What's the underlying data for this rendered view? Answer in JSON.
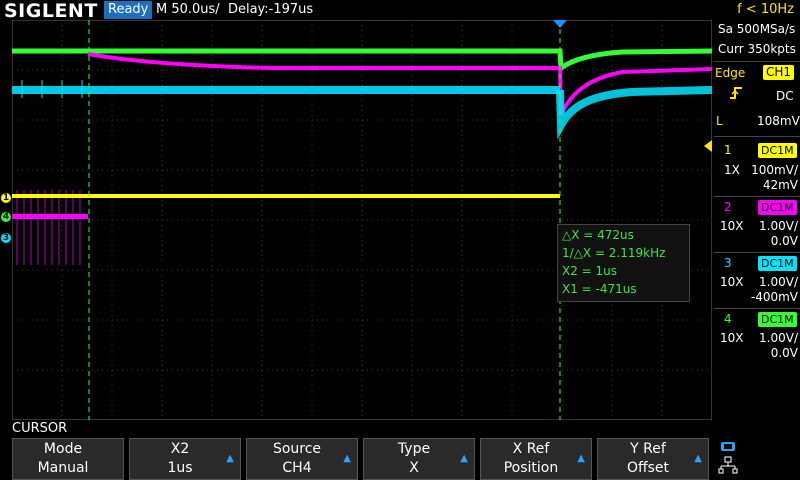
{
  "header": {
    "logo": "SIGLENT",
    "status": "Ready",
    "timebase": "M 50.0us/",
    "delay": "Delay:-197us",
    "trigger_freq": "f < 10Hz"
  },
  "acquisition": {
    "sample_rate": "Sa 500MSa/s",
    "memory": "Curr 350kpts"
  },
  "trigger": {
    "type": "Edge",
    "source": "CH1",
    "coupling": "DC",
    "level_label": "L",
    "level": "108mV"
  },
  "channels": [
    {
      "num": "1",
      "coupling": "DC1M",
      "probe": "1X",
      "scale": "100mV/",
      "offset": "42mV",
      "color": "#ffff00"
    },
    {
      "num": "2",
      "coupling": "DC1M",
      "probe": "10X",
      "scale": "1.00V/",
      "offset": "0.0V",
      "color": "#ff00ff"
    },
    {
      "num": "3",
      "coupling": "DC1M",
      "probe": "10X",
      "scale": "1.00V/",
      "offset": "-400mV",
      "color": "#00e5ff"
    },
    {
      "num": "4",
      "coupling": "DC1M",
      "probe": "10X",
      "scale": "1.00V/",
      "offset": "0.0V",
      "color": "#33ff33"
    }
  ],
  "cursor_readout": {
    "dx": "△X = 472us",
    "inv_dx": "1/△X = 2.119kHz",
    "x2": "X2 = 1us",
    "x1": "X1 = -471us"
  },
  "menu": {
    "title": "CURSOR",
    "softkeys": [
      {
        "title": "Mode",
        "value": "Manual",
        "arrow": false
      },
      {
        "title": "X2",
        "value": "1us",
        "arrow": true
      },
      {
        "title": "Source",
        "value": "CH4",
        "arrow": true
      },
      {
        "title": "Type",
        "value": "X",
        "arrow": true
      },
      {
        "title": "X Ref",
        "value": "Position",
        "arrow": true
      },
      {
        "title": "Y Ref",
        "value": "Offset",
        "arrow": true
      }
    ]
  },
  "colors": {
    "ch1": "#ffff00",
    "ch2": "#ff00ff",
    "ch3": "#00e5ff",
    "ch4": "#33ff33",
    "accent": "#1c6fbf",
    "trigger": "#1e90ff"
  }
}
